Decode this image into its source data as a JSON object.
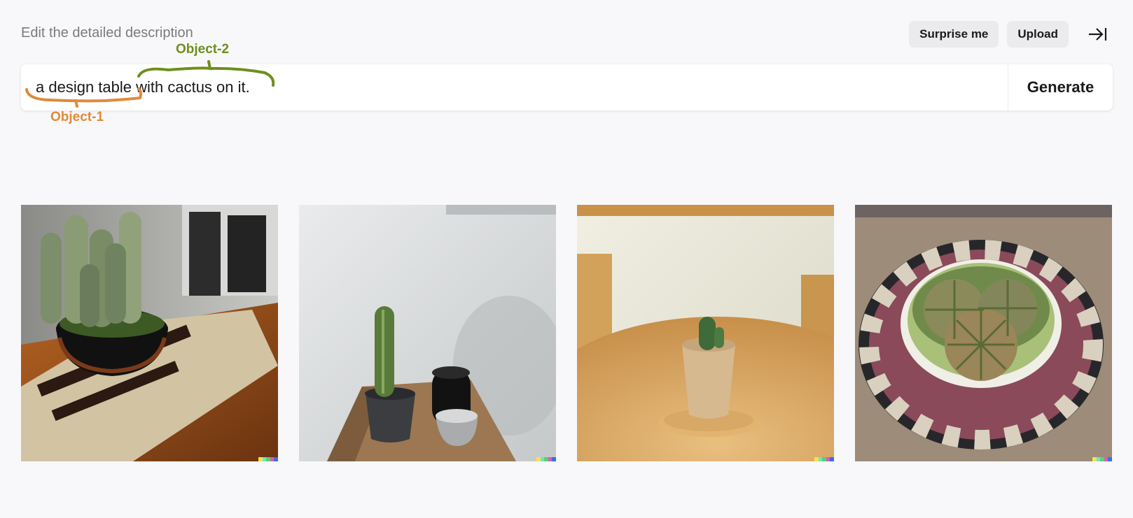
{
  "header": {
    "hint": "Edit the detailed description",
    "surprise_label": "Surprise me",
    "upload_label": "Upload",
    "collapse_icon": "arrow-right-to-bar-icon"
  },
  "prompt": {
    "text": "a design table with cactus on it.",
    "generate_label": "Generate"
  },
  "annotations": {
    "object1": {
      "label": "Object-1",
      "color": "#e08a3a"
    },
    "object2": {
      "label": "Object-2",
      "color": "#6e8f1c"
    }
  },
  "images": [
    {
      "name": "result-image-1",
      "description": "tall cacti in black bowl on wooden stand"
    },
    {
      "name": "result-image-2",
      "description": "single cactus in grey pot on wooden corner table"
    },
    {
      "name": "result-image-3",
      "description": "small cactus in beige pot on round wooden table"
    },
    {
      "name": "result-image-4",
      "description": "round cacti in patterned bowl on plate"
    }
  ]
}
